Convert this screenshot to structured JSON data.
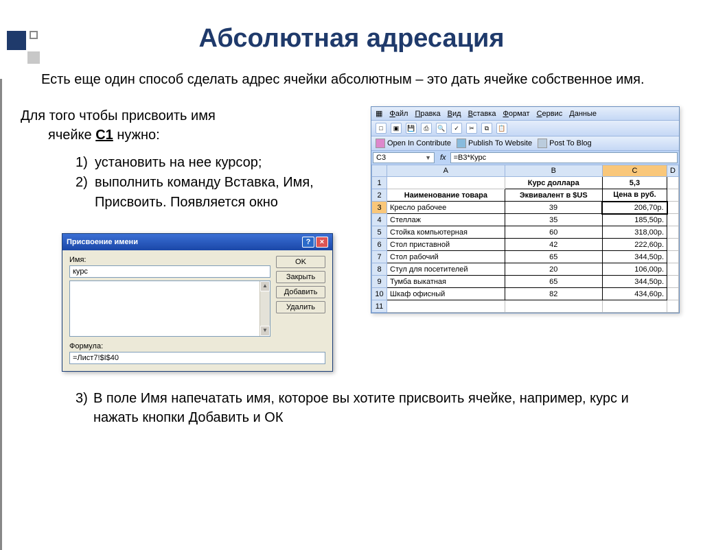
{
  "title": "Абсолютная адресация",
  "intro": "Есть еще один способ сделать адрес ячейки абсолютным – это дать ячейке собственное имя.",
  "subtext_line1": "Для того чтобы присвоить имя",
  "subtext_line2a": "ячейке ",
  "subtext_cell": "С1",
  "subtext_line2b": " нужно:",
  "steps": [
    {
      "n": "1)",
      "t": "установить на нее курсор;"
    },
    {
      "n": "2)",
      "t": "выполнить команду Вставка, Имя, Присвоить. Появляется окно"
    }
  ],
  "step3": {
    "n": "3)",
    "t": "В поле Имя напечатать имя, которое вы хотите присвоить ячейке, например, курс и нажать кнопки Добавить и ОК"
  },
  "dialog": {
    "title": "Присвоение имени",
    "name_label": "Имя:",
    "name_value": "курс",
    "formula_label": "Формула:",
    "formula_value": "=Лист7!$I$40",
    "buttons": {
      "ok": "OK",
      "close": "Закрыть",
      "add": "Добавить",
      "delete": "Удалить"
    }
  },
  "excel": {
    "menu": [
      "Файл",
      "Правка",
      "Вид",
      "Вставка",
      "Формат",
      "Сервис",
      "Данные"
    ],
    "contribute": [
      "Open In Contribute",
      "Publish To Website",
      "Post To Blog"
    ],
    "namebox": "C3",
    "formula": "=B3*Курс",
    "cols": [
      "",
      "A",
      "B",
      "C",
      "D"
    ],
    "row1": {
      "B": "Курс доллара",
      "C": "5,3"
    },
    "headers": {
      "A": "Наименование товара",
      "B": "Эквивалент в $US",
      "C": "Цена в руб."
    },
    "data": [
      {
        "r": "3",
        "a": "Кресло рабочее",
        "b": "39",
        "c": "206,70р."
      },
      {
        "r": "4",
        "a": "Стеллаж",
        "b": "35",
        "c": "185,50р."
      },
      {
        "r": "5",
        "a": "Стойка компьютерная",
        "b": "60",
        "c": "318,00р."
      },
      {
        "r": "6",
        "a": "Стол приставной",
        "b": "42",
        "c": "222,60р."
      },
      {
        "r": "7",
        "a": "Стол рабочий",
        "b": "65",
        "c": "344,50р."
      },
      {
        "r": "8",
        "a": "Стул для посетителей",
        "b": "20",
        "c": "106,00р."
      },
      {
        "r": "9",
        "a": "Тумба выкатная",
        "b": "65",
        "c": "344,50р."
      },
      {
        "r": "10",
        "a": "Шкаф офисный",
        "b": "82",
        "c": "434,60р."
      }
    ]
  }
}
